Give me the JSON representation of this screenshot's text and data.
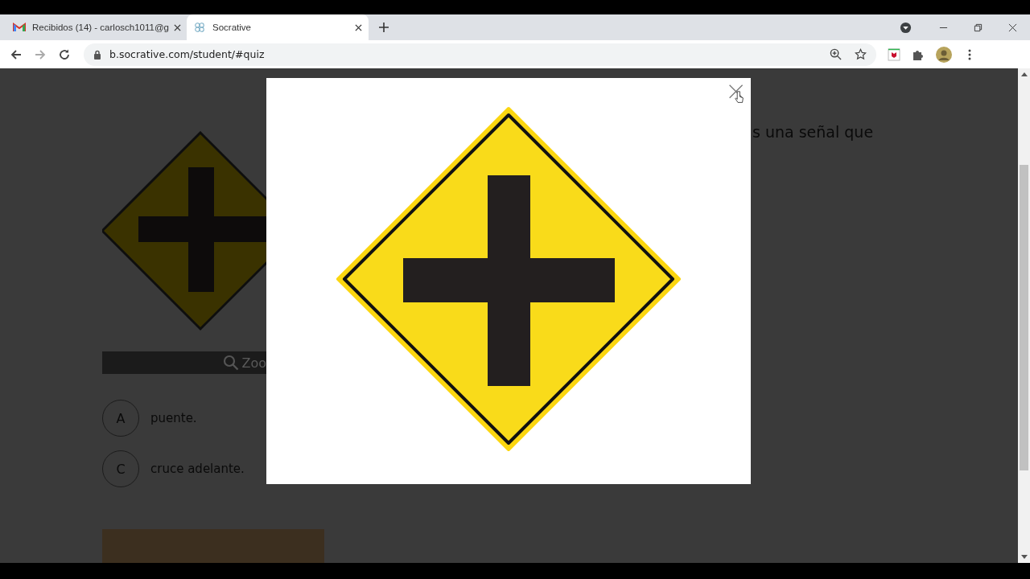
{
  "browser": {
    "tabs": [
      {
        "title": "Recibidos (14) - carlosch1011@g",
        "kind": "mail",
        "selected": false
      },
      {
        "title": "Socrative",
        "kind": "site",
        "selected": true
      }
    ],
    "url": "b.socrative.com/student/#quiz"
  },
  "quiz": {
    "question_visible": "s una señal que",
    "zoom_label": "Zoo",
    "answers": [
      {
        "letter": "A",
        "text": "puente."
      },
      {
        "letter": "C",
        "text": "cruce adelante."
      }
    ]
  },
  "modal": {
    "open": true
  }
}
